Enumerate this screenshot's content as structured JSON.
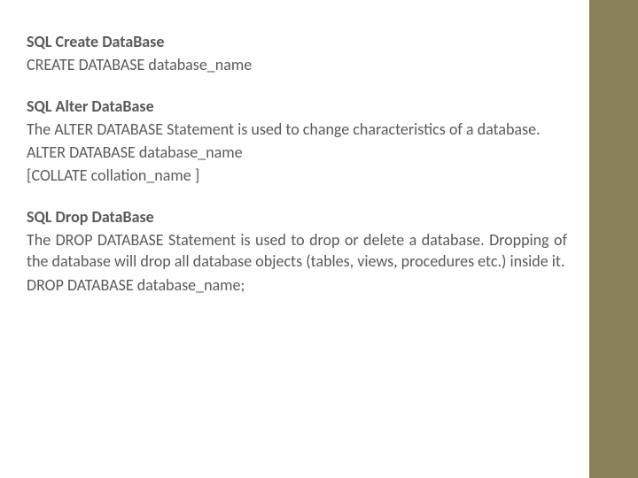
{
  "sections": {
    "create": {
      "title": "SQL Create DataBase",
      "syntax": "CREATE DATABASE database_name"
    },
    "alter": {
      "title": "SQL Alter DataBase",
      "desc": "The ALTER DATABASE Statement is used to change characteristics of a database.",
      "syntax1": "ALTER DATABASE database_name",
      "syntax2": "[COLLATE collation_name ]"
    },
    "drop": {
      "title": "SQL Drop DataBase",
      "desc": "The DROP DATABASE Statement is used to drop or delete a database. Dropping of the database will drop all database objects (tables, views, procedures etc.) inside it.",
      "syntax": "DROP DATABASE database_name;"
    }
  }
}
